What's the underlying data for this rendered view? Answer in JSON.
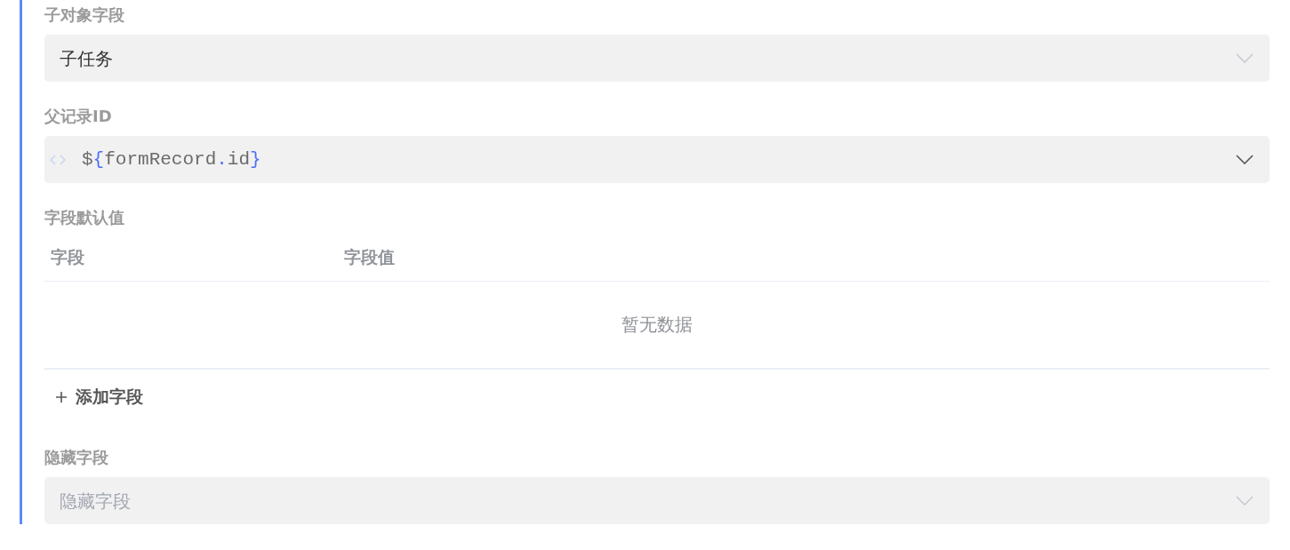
{
  "fields": [
    {
      "kind": "select",
      "label": "子对象字段",
      "value": "子任务"
    },
    {
      "kind": "expression",
      "label": "父记录ID",
      "tokens": [
        {
          "text": "$",
          "kind": "plain"
        },
        {
          "text": "{",
          "kind": "punct"
        },
        {
          "text": "formRecord",
          "kind": "plain"
        },
        {
          "text": ".",
          "kind": "punct"
        },
        {
          "text": "id",
          "kind": "plain"
        },
        {
          "text": "}",
          "kind": "punct"
        }
      ]
    },
    {
      "kind": "table",
      "label": "字段默认值",
      "columns": [
        "字段",
        "字段值"
      ],
      "empty_text": "暂无数据",
      "add_button": "添加字段"
    },
    {
      "kind": "select",
      "label": "隐藏字段",
      "placeholder": "隐藏字段"
    }
  ]
}
